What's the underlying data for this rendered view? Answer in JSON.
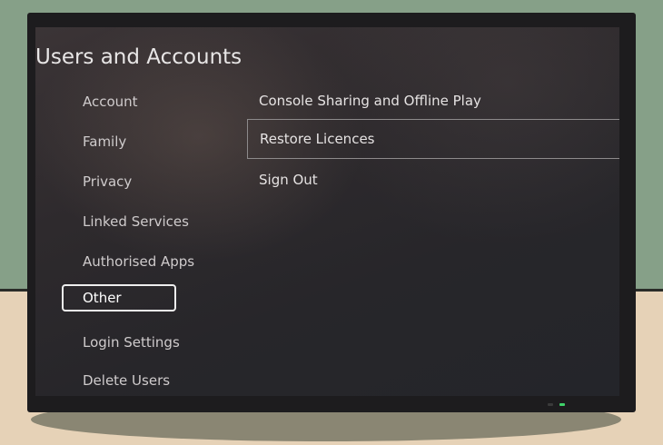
{
  "screen": {
    "title": "Users and Accounts"
  },
  "sidebar": {
    "items": [
      {
        "label": "Account"
      },
      {
        "label": "Family"
      },
      {
        "label": "Privacy"
      },
      {
        "label": "Linked Services"
      },
      {
        "label": "Authorised Apps"
      },
      {
        "label": "Other",
        "selected": true
      },
      {
        "label": "Login Settings"
      },
      {
        "label": "Delete Users"
      }
    ]
  },
  "content": {
    "options": [
      {
        "label": "Console Sharing and Offline Play"
      },
      {
        "label": "Restore Licences",
        "focused": true
      },
      {
        "label": "Sign Out"
      }
    ]
  },
  "colors": {
    "wall": "#86a088",
    "floor": "#e6d2b7",
    "tv_bezel": "#1d1c1e",
    "screen_bg": "#2c292c",
    "selection_border": "#eeeeee",
    "power_led": "#3fd36a"
  }
}
